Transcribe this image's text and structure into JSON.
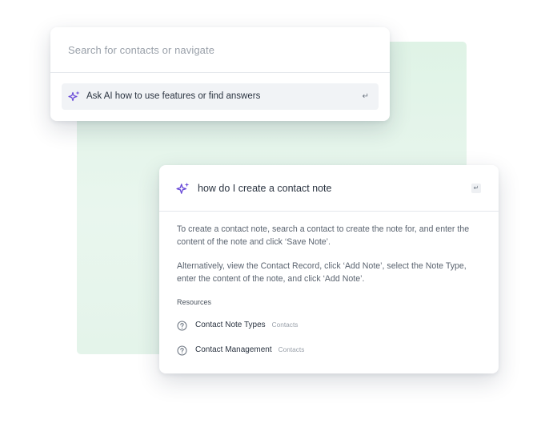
{
  "search": {
    "placeholder": "Search for contacts or navigate",
    "ai_option_label": "Ask AI how to use features or find answers",
    "enter_glyph": "↵"
  },
  "answer": {
    "query": "how do I create a contact note",
    "enter_glyph": "↵",
    "paragraphs": [
      "To create a contact note, search a contact to create the note for, and enter the content of the note and click ‘Save Note’.",
      "Alternatively, view the Contact Record, click ‘Add Note’, select the Note Type, enter the content of the note, and click ‘Add Note’."
    ],
    "resources_heading": "Resources",
    "resources": [
      {
        "title": "Contact Note Types",
        "tag": "Contacts",
        "icon": "help-circle-icon"
      },
      {
        "title": "Contact Management",
        "tag": "Contacts",
        "icon": "help-circle-icon"
      }
    ]
  },
  "colors": {
    "accent_purple": "#6a4bd8",
    "backdrop_green": "#e4f4ea",
    "text_dark": "#2a3340",
    "text_muted": "#9aa1aa"
  }
}
